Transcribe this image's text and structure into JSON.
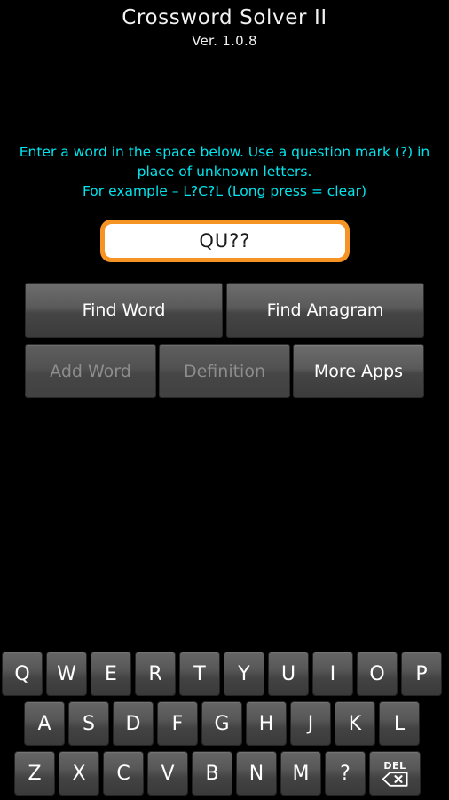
{
  "header": {
    "title": "Crossword Solver II",
    "version": "Ver. 1.0.8"
  },
  "instructions": {
    "line1": "Enter a word in the space below. Use a question mark (?) in",
    "line2": "place of unknown letters.",
    "line3": "For example – L?C?L (Long press = clear)"
  },
  "input": {
    "value": "QU??",
    "placeholder": ""
  },
  "buttons": {
    "find_word": {
      "label": "Find Word",
      "enabled": true
    },
    "find_anagram": {
      "label": "Find Anagram",
      "enabled": true
    },
    "add_word": {
      "label": "Add Word",
      "enabled": false
    },
    "definition": {
      "label": "Definition",
      "enabled": false
    },
    "more_apps": {
      "label": "More Apps",
      "enabled": true
    }
  },
  "keyboard": {
    "row1": [
      "Q",
      "W",
      "E",
      "R",
      "T",
      "Y",
      "U",
      "I",
      "O",
      "P"
    ],
    "row2": [
      "A",
      "S",
      "D",
      "F",
      "G",
      "H",
      "J",
      "K",
      "L"
    ],
    "row3": [
      "Z",
      "X",
      "C",
      "V",
      "B",
      "N",
      "M",
      "?"
    ],
    "delete_key": {
      "label": "DEL",
      "icon": "backspace-icon"
    }
  },
  "colors": {
    "background": "#000000",
    "instruction_text": "#00e5ee",
    "input_border": "#f59324",
    "input_background": "#ffffff",
    "button_text": "#ffffff",
    "button_text_disabled": "#8d8d8d",
    "title_text": "#f2f2f2"
  }
}
